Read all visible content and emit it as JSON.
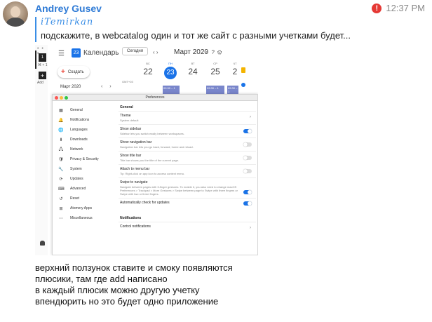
{
  "message": {
    "sender": "Andrey Gusev",
    "time": "12:37 PM",
    "reply": {
      "name": "iTemirkan",
      "text": "подскажите, в webcatalog один и тот же сайт с разными учетками будет..."
    },
    "body_lines": [
      "верхний ползунок ставите и смоку появляются",
      "плюсики, там где add написано",
      "в каждый плюсик можно другую учетку",
      "впендюрить но это будет одно приложение"
    ]
  },
  "screenshot": {
    "webcatalog": {
      "tab_number": "1",
      "tab_shortcut": "⌘ + 1",
      "add_label": "Add"
    },
    "calendar": {
      "logo_number": "23",
      "app_title": "Календарь",
      "today_button": "Сегодня",
      "month": "Март 2020",
      "create_button": "Создать",
      "mini_month": "Март 2020",
      "tz": "GMT+03",
      "days": [
        {
          "name": "ВС",
          "num": "22"
        },
        {
          "name": "ПН",
          "num": "23"
        },
        {
          "name": "ВТ",
          "num": "24"
        },
        {
          "name": "СР",
          "num": "25"
        },
        {
          "name": "ЧТ",
          "num": "2"
        }
      ],
      "events": [
        "09:30 – 1",
        "09:30 – 1",
        "09:30 – 1"
      ]
    },
    "preferences": {
      "title": "Preferences",
      "nav": [
        {
          "label": "General",
          "icon": "▦"
        },
        {
          "label": "Notifications",
          "icon": "🔔"
        },
        {
          "label": "Languages",
          "icon": "🌐"
        },
        {
          "label": "Downloads",
          "icon": "⬇"
        },
        {
          "label": "Network",
          "icon": "🖧"
        },
        {
          "label": "Privacy & Security",
          "icon": "🛡"
        },
        {
          "label": "System",
          "icon": "🔧"
        },
        {
          "label": "Updates",
          "icon": "⟳"
        },
        {
          "label": "Advanced",
          "icon": "⌨"
        },
        {
          "label": "Reset",
          "icon": "↺"
        },
        {
          "label": "Atomery Apps",
          "icon": "⊞"
        },
        {
          "label": "Miscellaneous",
          "icon": "⋯"
        }
      ],
      "general_section": "General",
      "notifications_section": "Notifications",
      "rows": {
        "theme": {
          "title": "Theme",
          "desc": "System default"
        },
        "sidebar": {
          "title": "Show sidebar",
          "desc": "Sidebar lets you switch easily between workspaces."
        },
        "navbar": {
          "title": "Show navigation bar",
          "desc": "Navigation bar lets you go back, forward, home and reload."
        },
        "titlebar": {
          "title": "Show title bar",
          "desc": "Title bar shows you the title of the current page."
        },
        "menubar": {
          "title": "Attach to menu bar",
          "desc": "Tip: Right-click on app icon to access context menu."
        },
        "swipe": {
          "title": "Swipe to navigate",
          "desc": "Navigate between pages with 3-finger gestures. To enable it, you also need to change macOS Preferences > Trackpad > More Gestures > Swipe between page to Swipe with three fingers or Swipe with two or three fingers."
        },
        "autocheck": {
          "title": "Automatically check for updates"
        },
        "notif_controls": {
          "title": "Control notifications"
        }
      }
    }
  }
}
